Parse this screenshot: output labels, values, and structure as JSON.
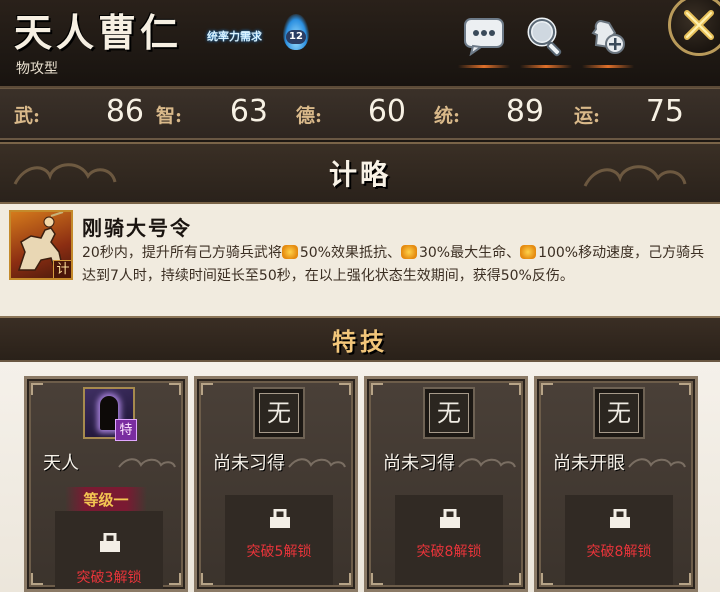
{
  "header": {
    "name": "天人曹仁",
    "type": "物攻型",
    "skill_tag": "统率力需求",
    "skill_level": "12",
    "buttons": {
      "chat": "chat-bubble-icon",
      "search": "magnifier-icon",
      "follow": "add-follow-icon",
      "close": "close-icon"
    }
  },
  "stats": [
    {
      "label": "武:",
      "value": "86"
    },
    {
      "label": "智:",
      "value": "63"
    },
    {
      "label": "德:",
      "value": "60"
    },
    {
      "label": "统:",
      "value": "89"
    },
    {
      "label": "运:",
      "value": "75"
    }
  ],
  "strategy": {
    "section_title": "计略",
    "badge": "计",
    "name": "刚骑大号令",
    "desc_1": "20秒内，提升所有己方骑兵武将",
    "desc_2": "50%效果抵抗、",
    "desc_3": "30%最大生命、",
    "desc_4": "100%移动速度，己方骑兵达到7人时，持续时间延长至50秒，在以上强化状态生效期间，获得50%反伤。"
  },
  "specials": {
    "section_title": "特技",
    "cards": [
      {
        "name": "天人",
        "level": "等级一",
        "icon_tag": "特",
        "unlock": "突破3解锁"
      },
      {
        "name": "尚未习得",
        "glyph": "无",
        "unlock": "突破5解锁"
      },
      {
        "name": "尚未习得",
        "glyph": "无",
        "unlock": "突破8解锁"
      },
      {
        "name": "尚未开眼",
        "glyph": "无",
        "unlock": "突破8解锁"
      }
    ]
  }
}
